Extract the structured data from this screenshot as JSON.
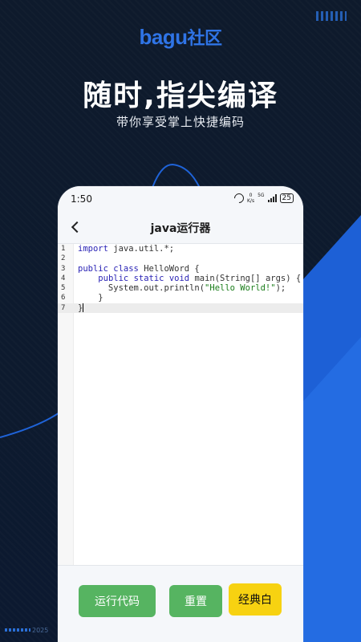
{
  "promo": {
    "brand_main": "bagu",
    "brand_suffix": "社区",
    "headline": "随时,指尖编译",
    "subline": "带你享受掌上快捷编码",
    "year": "2025"
  },
  "status_bar": {
    "time": "1:50",
    "net_speed_value": "0",
    "net_speed_unit": "K/s",
    "signal_label": "5G",
    "battery": "25"
  },
  "app": {
    "title": "java运行器",
    "back_icon": "chevron-left-icon"
  },
  "editor": {
    "lines": [
      {
        "num": "1",
        "segments": [
          {
            "t": "import",
            "c": "kw"
          },
          {
            "t": " java.util.*;",
            "c": ""
          }
        ]
      },
      {
        "num": "2",
        "segments": []
      },
      {
        "num": "3",
        "segments": [
          {
            "t": "public",
            "c": "kw"
          },
          {
            "t": " ",
            "c": ""
          },
          {
            "t": "class",
            "c": "kw"
          },
          {
            "t": " HelloWord {",
            "c": ""
          }
        ]
      },
      {
        "num": "4",
        "segments": [
          {
            "t": "    ",
            "c": ""
          },
          {
            "t": "public",
            "c": "kw"
          },
          {
            "t": " ",
            "c": ""
          },
          {
            "t": "static",
            "c": "kw"
          },
          {
            "t": " ",
            "c": ""
          },
          {
            "t": "void",
            "c": "kw"
          },
          {
            "t": " main(String[] args) {",
            "c": ""
          }
        ]
      },
      {
        "num": "5",
        "segments": [
          {
            "t": "      System.out.println(",
            "c": ""
          },
          {
            "t": "\"Hello World!\"",
            "c": "str"
          },
          {
            "t": ");",
            "c": ""
          }
        ]
      },
      {
        "num": "6",
        "segments": [
          {
            "t": "    }",
            "c": ""
          }
        ]
      },
      {
        "num": "7",
        "segments": [
          {
            "t": "}",
            "c": ""
          }
        ],
        "active": true
      }
    ]
  },
  "buttons": {
    "run": "运行代码",
    "reset": "重置",
    "theme": "经典白"
  },
  "colors": {
    "brand": "#2f74e6",
    "button_green": "#56b461",
    "button_yellow": "#f7d211",
    "keyword": "#2a23b5",
    "string": "#1a7d1a"
  }
}
